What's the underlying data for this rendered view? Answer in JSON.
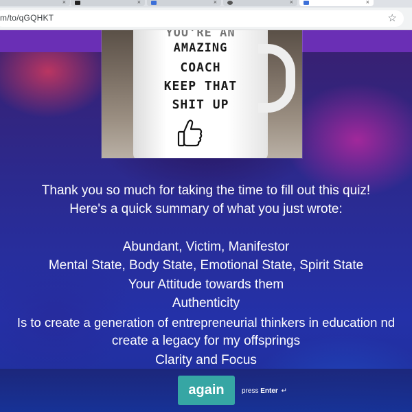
{
  "browser": {
    "url_partial": "m/to/qGQHKT",
    "star_icon": "star-outline-icon"
  },
  "hero": {
    "mug_lines": [
      "YOU'RE AN",
      "AMAZING",
      "COACH",
      "KEEP THAT",
      "SHIT UP"
    ],
    "thumb_icon": "thumbs-up-icon"
  },
  "message": {
    "line1": "Thank you so much for taking the time to fill out this quiz!",
    "line2": "Here's a quick summary of what you just wrote:"
  },
  "summary": [
    "Abundant, Victim, Manifestor",
    "Mental State, Body State, Emotional State, Spirit State",
    "Your Attitude towards them",
    "Authenticity",
    "Is to create a generation of entrepreneurial thinkers in education nd",
    "create a legacy for my offsprings",
    "Clarity and Focus"
  ],
  "footer": {
    "again_label": "again",
    "press_label": "press",
    "enter_label": "Enter",
    "enter_icon": "enter-return-icon"
  },
  "colors": {
    "accent_button": "#36a6a4",
    "purple_band": "#6a2fb5",
    "text": "#ffffff"
  }
}
